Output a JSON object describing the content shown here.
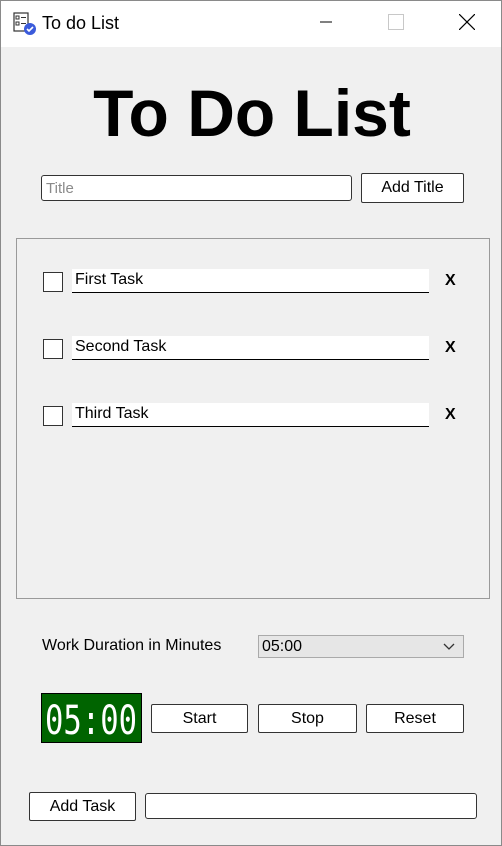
{
  "window": {
    "title": "To do List"
  },
  "heading": "To Do List",
  "title_row": {
    "placeholder": "Title",
    "value": "",
    "add_button": "Add Title"
  },
  "tasks": [
    {
      "label": "First Task",
      "checked": false,
      "delete": "X"
    },
    {
      "label": "Second Task",
      "checked": false,
      "delete": "X"
    },
    {
      "label": "Third Task",
      "checked": false,
      "delete": "X"
    }
  ],
  "duration": {
    "label": "Work Duration in Minutes",
    "selected": "05:00"
  },
  "timer": {
    "display": "05:00",
    "digit_color": "#ffffff",
    "background": "#006400",
    "start": "Start",
    "stop": "Stop",
    "reset": "Reset"
  },
  "add_task": {
    "button": "Add Task",
    "value": ""
  },
  "icons": {
    "app": "checklist-icon",
    "minimize": "minimize-icon",
    "maximize": "maximize-icon",
    "close": "close-icon",
    "dropdown": "chevron-down-icon"
  }
}
